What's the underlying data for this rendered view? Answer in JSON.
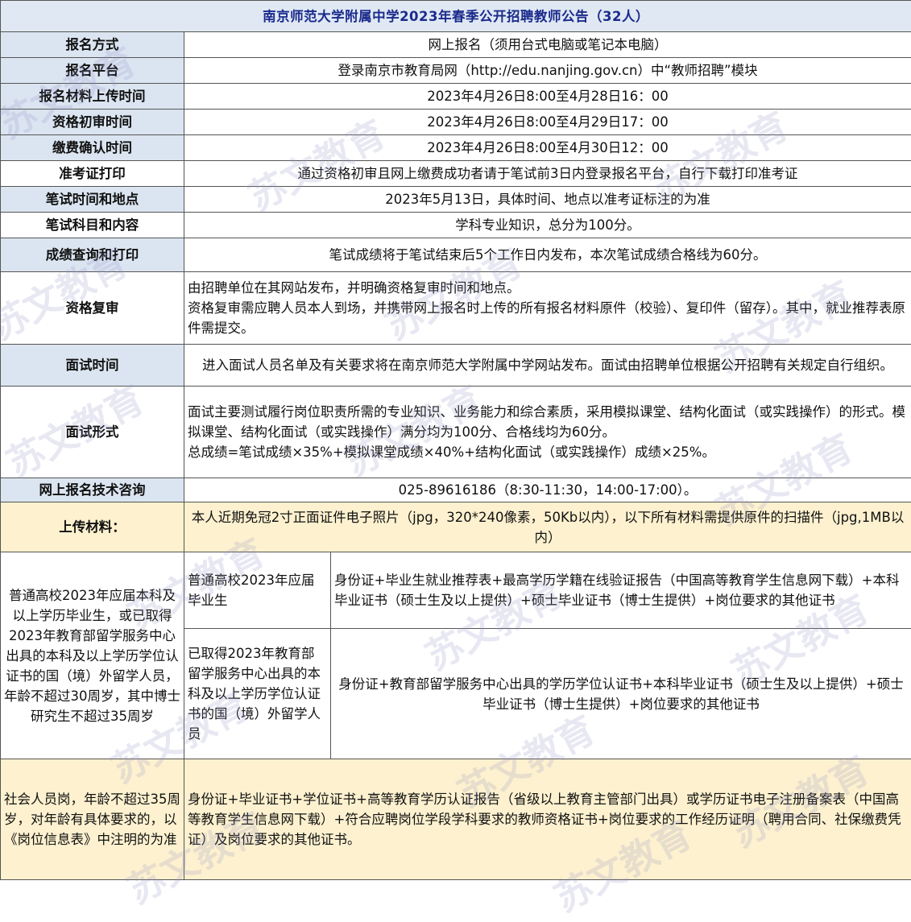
{
  "title": "南京师范大学附属中学2023年春季公开招聘教师公告（32人）",
  "rows": {
    "method": {
      "label": "报名方式",
      "value": "网上报名（须用台式电脑或笔记本电脑）"
    },
    "platform": {
      "label": "报名平台",
      "value": "登录南京市教育局网（http://edu.nanjing.gov.cn）中“教师招聘”模块"
    },
    "upload_time": {
      "label": "报名材料上传时间",
      "value": "2023年4月26日8:00至4月28日16：00"
    },
    "review_time": {
      "label": "资格初审时间",
      "value": "2023年4月26日8:00至4月29日17：00"
    },
    "payment_time": {
      "label": "缴费确认时间",
      "value": "2023年4月26日8:00至4月30日12：00"
    },
    "admission": {
      "label": "准考证打印",
      "value": "通过资格初审且网上缴费成功者请于笔试前3日内登录报名平台，自行下载打印准考证"
    },
    "exam_time": {
      "label": "笔试时间和地点",
      "value": "2023年5月13日，具体时间、地点以准考证标注的为准"
    },
    "exam_subject": {
      "label": "笔试科目和内容",
      "value": "学科专业知识，总分为100分。"
    },
    "score_query": {
      "label": "成绩查询和打印",
      "value": "笔试成绩将于笔试结束后5个工作日内发布，本次笔试成绩合格线为60分。"
    },
    "recheck": {
      "label": "资格复审",
      "line1": "由招聘单位在其网站发布，并明确资格复审时间和地点。",
      "line2": "资格复审需应聘人员本人到场，并携带网上报名时上传的所有报名材料原件（校验）、复印件（留存）。其中，就业推荐表原件需提交。"
    },
    "interview_time": {
      "label": "面试时间",
      "value": "进入面试人员名单及有关要求将在南京师范大学附属中学网站发布。面试由招聘单位根据公开招聘有关规定自行组织。"
    },
    "interview_form": {
      "label": "面试形式",
      "line1": "面试主要测试履行岗位职责所需的专业知识、业务能力和综合素质，采用模拟课堂、结构化面试（或实践操作）的形式。模拟课堂、结构化面试（或实践操作）满分均为100分、合格线均为60分。",
      "line2": "总成绩=笔试成绩×35%+模拟课堂成绩×40%+结构化面试（或实践操作）成绩×25%。"
    },
    "consult": {
      "label": "网上报名技术咨询",
      "value": "025-89616186（8:30-11:30，14:00-17:00）。"
    },
    "upload_materials": {
      "label": "上传材料：",
      "value": "本人近期免冠2寸正面证件电子照片（jpg，320*240像素，50Kb以内），以下所有材料需提供原件的扫描件（jpg,1MB以内）"
    }
  },
  "materials": {
    "group1_desc": "普通高校2023年应届本科及以上学历毕业生，或已取得2023年教育部留学服务中心出具的本科及以上学历学位认证书的国（境）外留学人员，年龄不超过30周岁，其中博士研究生不超过35周岁",
    "sub1_label": "普通高校2023年应届毕业生",
    "sub1_docs": "身份证+毕业生就业推荐表+最高学历学籍在线验证报告（中国高等教育学生信息网下载）+本科毕业证书（硕士生及以上提供）+硕士毕业证书（博士生提供）+岗位要求的其他证书",
    "sub2_label": "已取得2023年教育部留学服务中心出具的本科及以上学历学位认证书的国（境）外留学人员",
    "sub2_docs": "身份证+教育部留学服务中心出具的学历学位认证书+本科毕业证书（硕士生及以上提供）+硕士毕业证书（博士生提供）+岗位要求的其他证书",
    "group2_desc": "社会人员岗，年龄不超过35周岁，对年龄有具体要求的，以《岗位信息表》中注明的为准",
    "group2_docs": "身份证+毕业证书+学位证书+高等教育学历认证报告（省级以上教育主管部门出具）或学历证书电子注册备案表（中国高等教育学生信息网下载）+符合应聘岗位学段学科要求的教师资格证书+岗位要求的工作经历证明（聘用合同、社保缴费凭证）及岗位要求的其他证书。"
  },
  "watermark": "苏文教育"
}
